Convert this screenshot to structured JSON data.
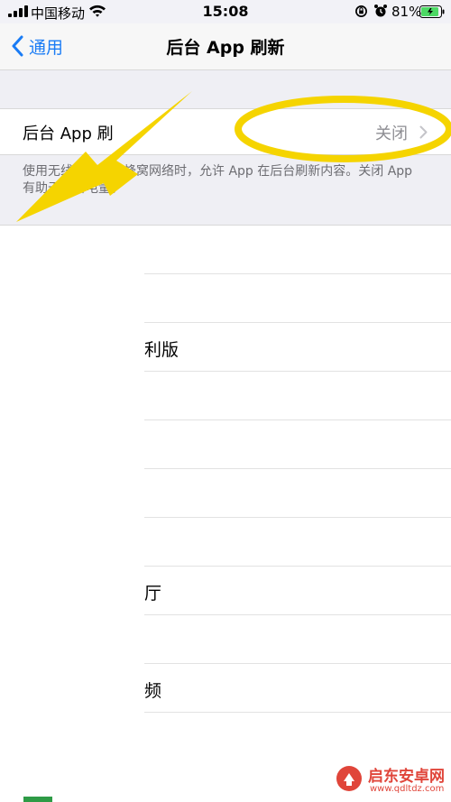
{
  "status_bar": {
    "carrier": "中国移动",
    "time": "15:08",
    "battery_percent": "81%",
    "icons": [
      "signal-icon",
      "wifi-icon",
      "rotation-lock-icon",
      "alarm-icon",
      "battery-icon"
    ]
  },
  "nav": {
    "back_label": "通用",
    "title": "后台 App 刷新"
  },
  "main_row": {
    "label": "后台 App 刷新",
    "visible_label": "后台 App 刷",
    "value": "关闭"
  },
  "footer": {
    "text": "使用无线局域网或蜂窝网络时，允许 App 在后台刷新内容。关闭 App 有助于节省电量。"
  },
  "list_rows": [
    "",
    "",
    "利版",
    "",
    "",
    "",
    "",
    "厅",
    "",
    "频"
  ],
  "annotations": {
    "arrow_color": "#f5d400",
    "ellipse_color": "#f5d400"
  },
  "watermark": {
    "title": "启东安卓网",
    "url": "www.qdltdz.com"
  },
  "colors": {
    "accent": "#1a7cf5",
    "group_background": "#efeff4",
    "secondary_text": "#8e8e93"
  }
}
